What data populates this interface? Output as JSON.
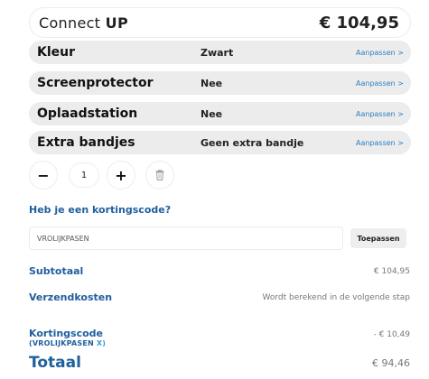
{
  "product": {
    "name_prefix": "Connect",
    "name_suffix": "UP",
    "price": "€ 104,95"
  },
  "options": [
    {
      "label": "Kleur",
      "value": "Zwart",
      "link": "Aanpassen >"
    },
    {
      "label": "Screenprotector",
      "value": "Nee",
      "link": "Aanpassen >"
    },
    {
      "label": "Oplaadstation",
      "value": "Nee",
      "link": "Aanpassen >"
    },
    {
      "label": "Extra bandjes",
      "value": "Geen extra bandje",
      "link": "Aanpassen >"
    }
  ],
  "quantity": {
    "minus": "−",
    "value": "1",
    "plus": "+"
  },
  "discount": {
    "title": "Heb je een kortingscode?",
    "input_value": "VROLIJKPASEN",
    "apply_label": "Toepassen"
  },
  "summary": {
    "subtotal_label": "Subtotaal",
    "subtotal_value": "€ 104,95",
    "shipping_label": "Verzendkosten",
    "shipping_value": "Wordt berekend in de volgende stap",
    "code_label": "Kortingscode",
    "code_name": "(VROLIJKPASEN",
    "code_remove": "X)",
    "code_value": "- € 10,49",
    "total_label": "Totaal",
    "total_value": "€ 94,46"
  },
  "colors": {
    "accent": "#1f5f9e",
    "link": "#2b7fc3",
    "row_bg": "#ececec"
  }
}
